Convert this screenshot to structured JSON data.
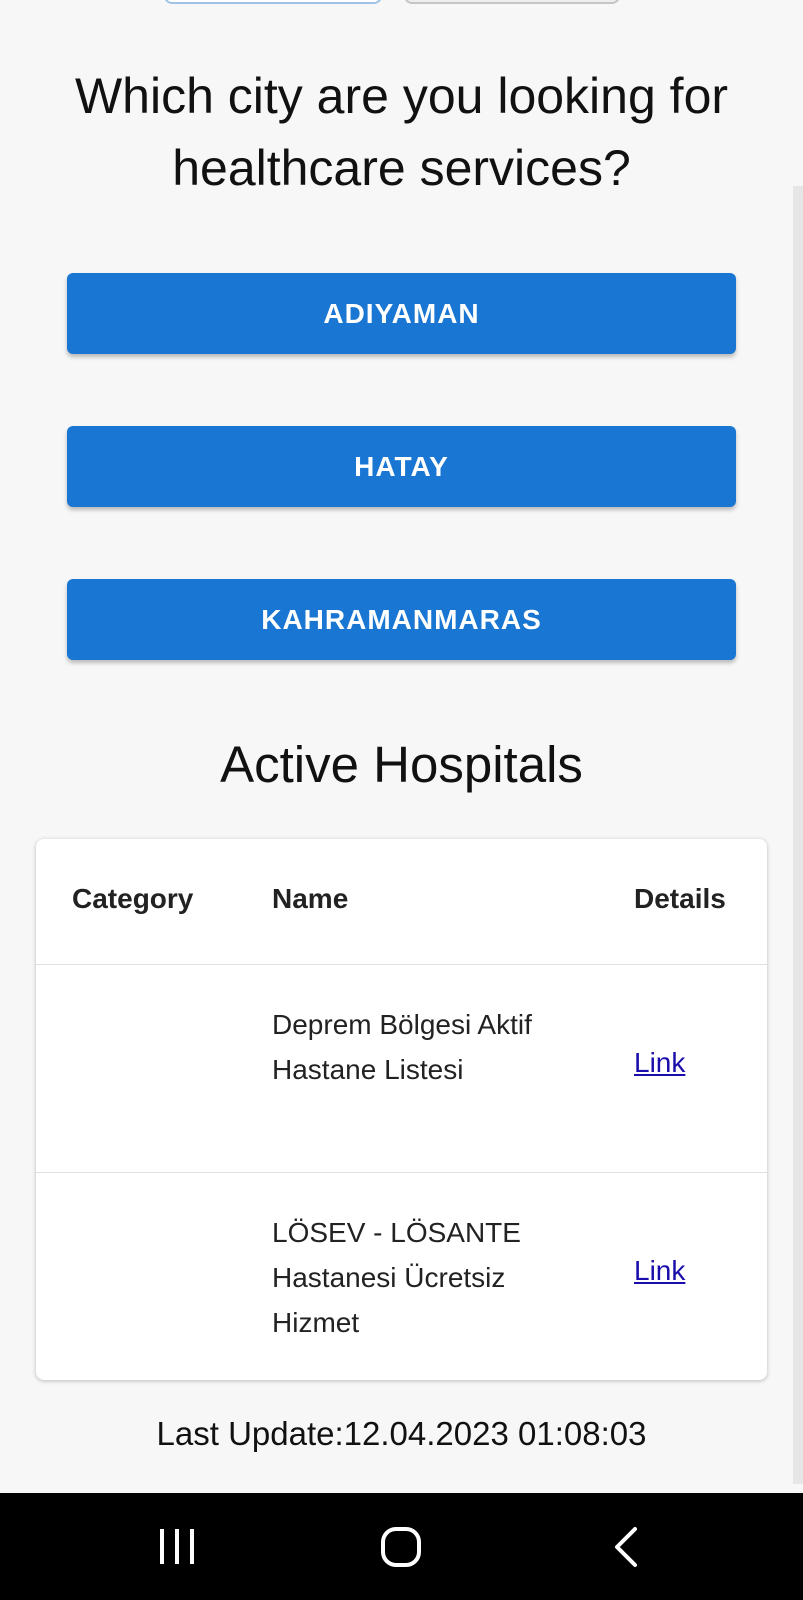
{
  "question": {
    "text": "Which city are you looking for healthcare services?"
  },
  "cities": [
    {
      "label": "ADIYAMAN"
    },
    {
      "label": "HATAY"
    },
    {
      "label": "KAHRAMANMARAS"
    }
  ],
  "hospitals": {
    "title": "Active Hospitals",
    "columns": {
      "category": "Category",
      "name": "Name",
      "details": "Details"
    },
    "rows": [
      {
        "category": "",
        "name": "Deprem Bölgesi Aktif Hastane Listesi",
        "details": "Link"
      },
      {
        "category": "",
        "name": "LÖSEV - LÖSANTE Hastanesi Ücretsiz Hizmet",
        "details": "Link"
      }
    ]
  },
  "footer": {
    "last_update": "Last Update:12.04.2023 01:08:03"
  },
  "nav": {
    "recents_icon": "recent-apps-icon",
    "home_icon": "home-icon",
    "back_icon": "back-icon"
  },
  "colors": {
    "button": "#1976d2",
    "link": "#1a0dab",
    "background": "#f7f7f7"
  }
}
